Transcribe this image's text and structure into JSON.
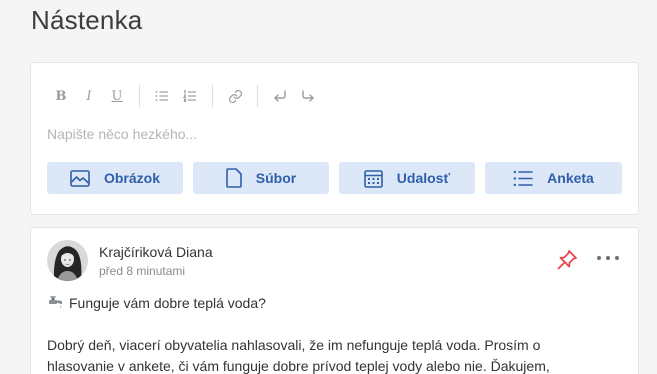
{
  "page": {
    "title": "Nástenka"
  },
  "composer": {
    "toolbar": {
      "bold": "B",
      "italic": "I",
      "underline": "U"
    },
    "placeholder": "Napište něco hezkého...",
    "attachments": [
      {
        "label": "Obrázok",
        "icon": "image-icon"
      },
      {
        "label": "Súbor",
        "icon": "file-icon"
      },
      {
        "label": "Udalosť",
        "icon": "calendar-icon"
      },
      {
        "label": "Anketa",
        "icon": "list-icon"
      }
    ]
  },
  "post": {
    "author": "Krajčíriková Diana",
    "time": "před 8 minutami",
    "headline": "Funguje vám dobre teplá voda?",
    "body": "Dobrý deň, viacerí obyvatelia nahlasovali, že im nefunguje teplá voda. Prosím o hlasovanie v ankete, či vám funguje dobre prívod teplej vody alebo nie. Ďakujem,"
  },
  "colors": {
    "accent": "#2f5fa8",
    "accent_bg": "#dce8f8",
    "pin": "#e5484d"
  }
}
